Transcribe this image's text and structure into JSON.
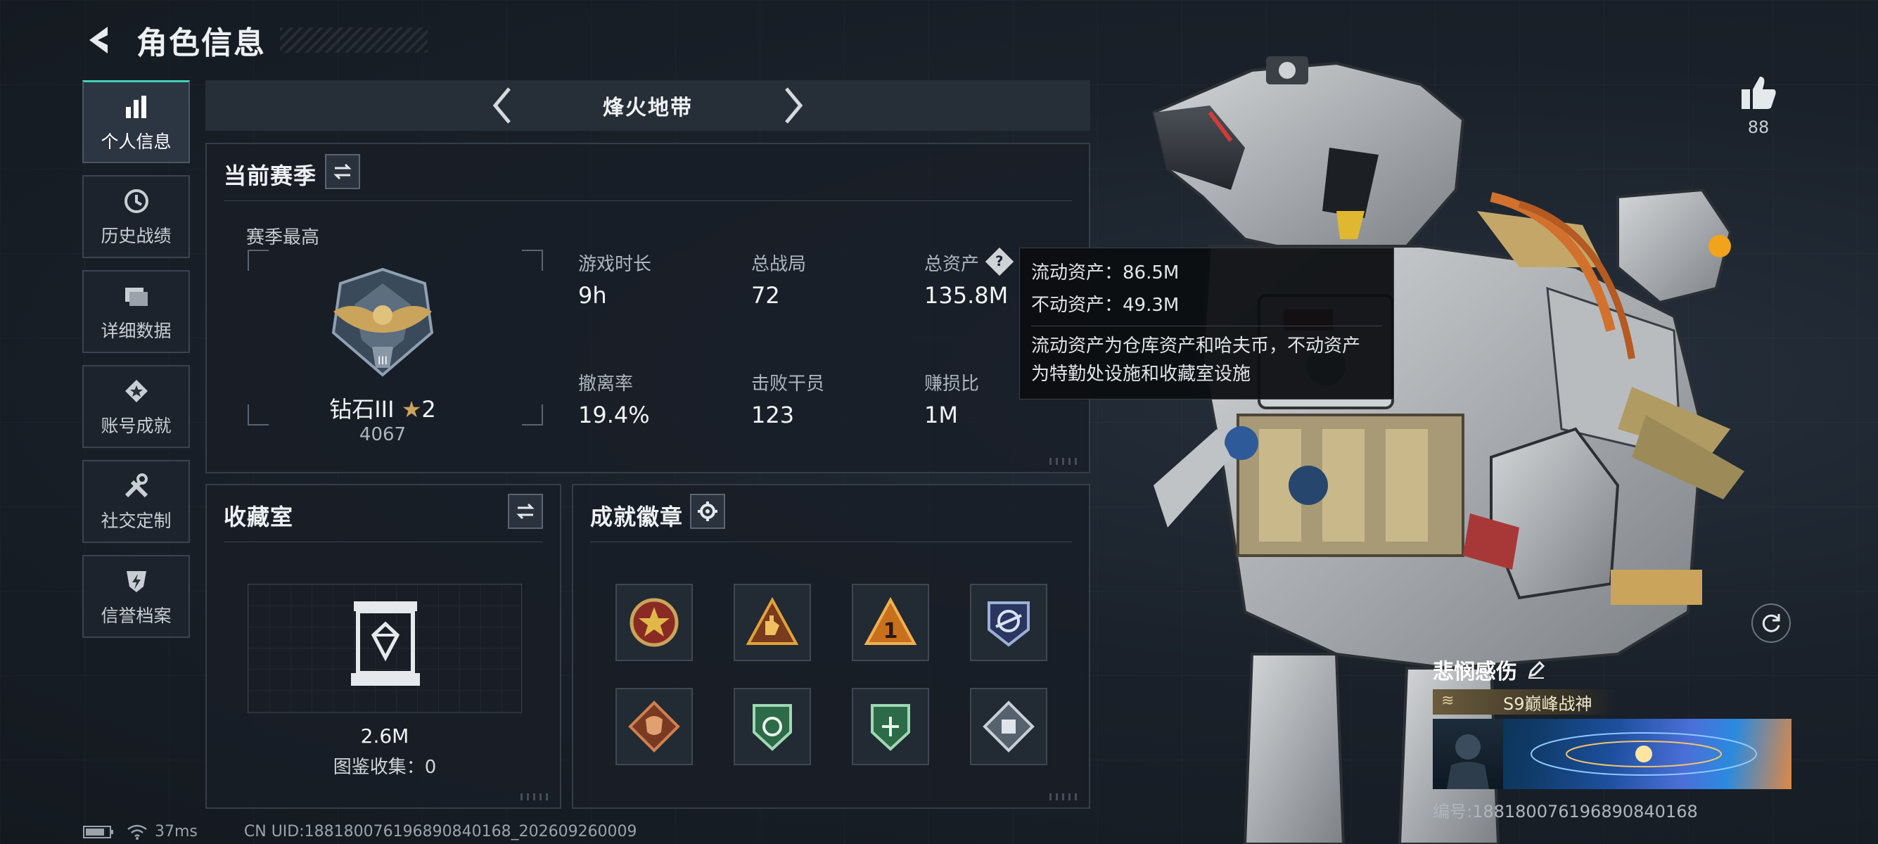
{
  "header": {
    "title": "角色信息"
  },
  "sidebar": {
    "items": [
      {
        "label": "个人信息",
        "active": true,
        "icon": "bar-chart-icon"
      },
      {
        "label": "历史战绩",
        "active": false,
        "icon": "history-clock-icon"
      },
      {
        "label": "详细数据",
        "active": false,
        "icon": "folders-icon"
      },
      {
        "label": "账号成就",
        "active": false,
        "icon": "achievement-star-icon"
      },
      {
        "label": "社交定制",
        "active": false,
        "icon": "tools-icon"
      },
      {
        "label": "信誉档案",
        "active": false,
        "icon": "shield-bolt-icon"
      }
    ]
  },
  "mode": {
    "title": "烽火地带"
  },
  "season": {
    "title": "当前赛季",
    "best_label": "赛季最高",
    "rank_name": "钻石III",
    "rank_stars": "2",
    "rank_points": "4067",
    "stats": [
      {
        "label": "游戏时长",
        "value": "9h"
      },
      {
        "label": "总战局",
        "value": "72"
      },
      {
        "label": "总资产",
        "value": "135.8M"
      },
      {
        "label": "撤离率",
        "value": "19.4%"
      },
      {
        "label": "击败干员",
        "value": "123"
      },
      {
        "label": "赚损比",
        "value": "1M"
      }
    ]
  },
  "tooltip": {
    "line1": "流动资产：86.5M",
    "line2": "不动资产：49.3M",
    "desc1": "流动资产为仓库资产和哈夫币，不动资产",
    "desc2": "为特勤处设施和收藏室设施"
  },
  "collection": {
    "title": "收藏室",
    "value": "2.6M",
    "count_text": "图鉴收集：0"
  },
  "badges": {
    "title": "成就徽章",
    "items": [
      "star-badge-icon",
      "hand-badge-icon",
      "number-one-badge-icon",
      "eagle-badge-icon",
      "dragon-badge-icon",
      "green-shield-badge-icon",
      "green-shield-badge-icon",
      "diamond-badge-icon"
    ]
  },
  "likes": {
    "count": "88"
  },
  "namecard": {
    "name": "悲悯感伤",
    "title": "S9巅峰战神",
    "id_text": "编号:1881800761968908401​68"
  },
  "status": {
    "ping": "37ms",
    "uid": "CN UID:1881800761968908401​68_202609260009"
  },
  "colors": {
    "accent": "#3fd0b5",
    "panel": "#181e26",
    "gold": "#c9a45a"
  }
}
